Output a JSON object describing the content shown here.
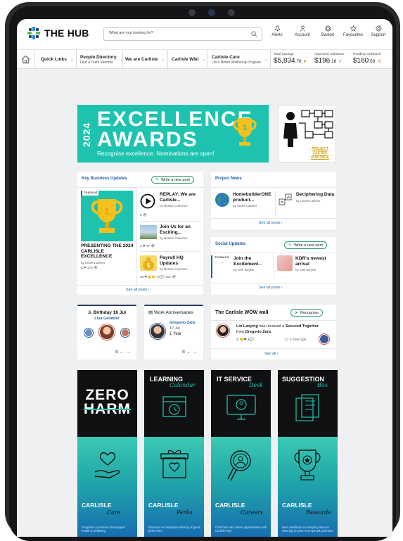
{
  "header": {
    "logo_text": "THE HUB",
    "search_placeholder": "What are you looking for?",
    "icons": [
      {
        "label": "Alerts",
        "icon": "bell-icon"
      },
      {
        "label": "Account",
        "icon": "user-icon"
      },
      {
        "label": "Basket",
        "icon": "basket-icon"
      },
      {
        "label": "Favourites",
        "icon": "star-icon"
      },
      {
        "label": "Support",
        "icon": "help-icon"
      }
    ]
  },
  "nav": {
    "quick_links": "Quick Links",
    "people_directory": "People Directory",
    "people_directory_sub": "Find a Team Member",
    "we_are_carlisle": "We are Carlisle",
    "carlisle_wiki": "Carlisle Wiki",
    "carlisle_care": "Carlisle Care",
    "carlisle_care_sub": "Life's Better Wellbeing Program",
    "total_savings_label": "Total Savings",
    "total_savings_main": "$5,834",
    "total_savings_cents": ".76",
    "approved_label": "Approved cashback",
    "approved_main": "$196",
    "approved_cents": ".18",
    "pending_label": "Pending cashback",
    "pending_main": "$160",
    "pending_cents": ".58"
  },
  "banner": {
    "year": "2024",
    "title_line1": "EXCELLENCE",
    "title_line2": "AWARDS",
    "subtitle": "Recognise excellence. Nominations are open!"
  },
  "project_promo": {
    "caption_line1": "PROJECT FASTER",
    "caption_line2": "HUB PAGE"
  },
  "key_updates": {
    "title": "Key Business Updates",
    "write_post": "Write a new post",
    "featured_tag": "Featured",
    "featured_title": "PRESENTING THE 2024 CARLISLE EXCELLENCE",
    "featured_by": "by Lewis Latimer",
    "featured_meta": "8 ❤  175 👁",
    "items": [
      {
        "title": "REPLAY: We are Carlisle...",
        "by": "by Bessie Coleman",
        "meta": "6 👁"
      },
      {
        "title": "Join Us for an Exciting...",
        "by": "by Bessie Coleman",
        "meta": "3 ❤  57 👁"
      },
      {
        "title": "Payroll HQ Updates",
        "by": "by Bessie Coleman",
        "meta": "28 ❤👍👏  73 💬  401 👁"
      }
    ],
    "see_all": "See all posts ›"
  },
  "project_news": {
    "title": "Project News",
    "items": [
      {
        "title": "HomebuilderONE product...",
        "by": "by Lewis Latimer"
      },
      {
        "title": "Deciphering Data",
        "by": "by Lewis Latimer"
      }
    ],
    "see_all": "See all posts ›"
  },
  "social_updates": {
    "title": "Social Updates",
    "write_post": "Write a new post",
    "featured_tag": "Featured",
    "items": [
      {
        "title": "Join the Excitement...",
        "by": "by Otis Boykin"
      },
      {
        "title": "KDR's newest arrival",
        "by": "by Otis Boykin"
      }
    ],
    "see_all": "See all posts ›"
  },
  "birthday": {
    "title": "Birthday 18 Jul",
    "name": "Lisa Gelobter",
    "controls": "II ← →"
  },
  "anniversaries": {
    "title": "Work Anniversaries",
    "name": "Gregorio Zara",
    "date": "17 Jul",
    "years": "1 Year",
    "controls": "II ← →"
  },
  "wow_wall": {
    "title": "The Carlisle WOW wall",
    "recognise": "Recognise",
    "giver": "Lin Lanying",
    "text_mid": " has received a ",
    "award": "Succeed Together",
    "from_prefix": "from ",
    "from": "Gregorio Zara",
    "reactions": "2 👏❤  1💬",
    "time": "🕒 1 hour ago",
    "see_all": "See all ›"
  },
  "tiles_row1": [
    {
      "name": "zero-harm",
      "line1": "ZERO",
      "line2": "HARM"
    },
    {
      "name": "learning-calendar",
      "line1": "LEARNING",
      "line2": "Calendar"
    },
    {
      "name": "it-service-desk",
      "line1": "IT SERVICE",
      "line2": "Desk"
    },
    {
      "name": "suggestion-box",
      "line1": "SUGGESTION",
      "line2": "Box"
    }
  ],
  "tiles_row2": [
    {
      "head": "CARLISLE",
      "script": "Care",
      "desc": "Programs & services that support health & wellbeing"
    },
    {
      "head": "CARLISLE",
      "script": "Perks",
      "desc": "Discover our employee offering of great perks from"
    },
    {
      "head": "CARLISLE",
      "script": "Careers",
      "desc": "Click here into career opportunities with Carlisle from"
    },
    {
      "head": "CARLISLE",
      "script": "Rewards",
      "desc": "Earn cashback on everyday items & save big on your next special purchase"
    }
  ]
}
